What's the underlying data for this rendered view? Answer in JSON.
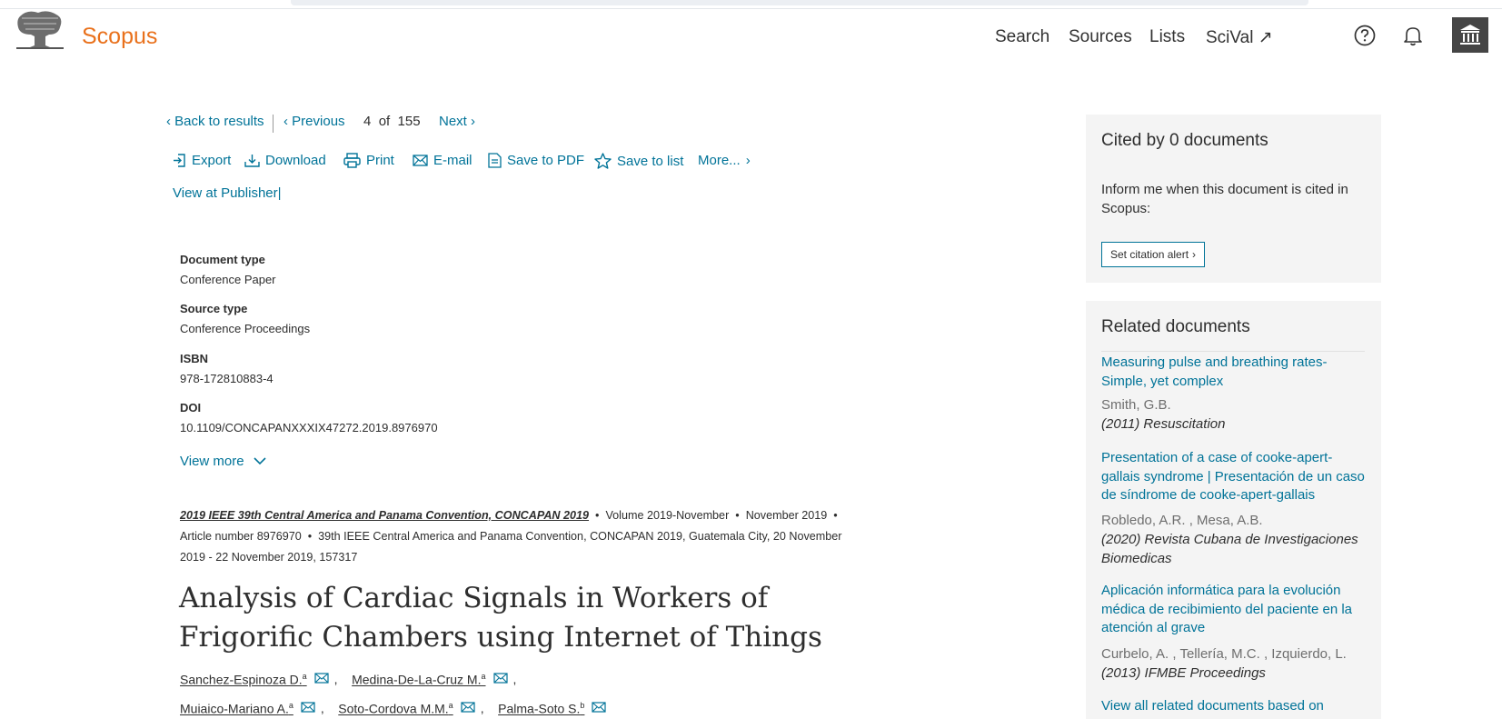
{
  "header": {
    "brand": "Scopus",
    "nav": {
      "search": "Search",
      "sources": "Sources",
      "lists": "Lists",
      "scival": "SciVal ↗"
    }
  },
  "nav": {
    "back": "Back to results",
    "previous": "Previous",
    "position": "4",
    "of": "of",
    "total": "155",
    "next": "Next"
  },
  "actions": {
    "export": "Export",
    "download": "Download",
    "print": "Print",
    "email": "E-mail",
    "save_pdf": "Save to PDF",
    "save_list": "Save to list",
    "more": "More...",
    "view_publisher": "View at Publisher|"
  },
  "metadata": {
    "document_type_label": "Document type",
    "document_type": "Conference Paper",
    "source_type_label": "Source type",
    "source_type": "Conference Proceedings",
    "isbn_label": "ISBN",
    "isbn": "978-172810883-4",
    "doi_label": "DOI",
    "doi": "10.1109/CONCAPANXXXIX47272.2019.8976970",
    "view_more": "View more"
  },
  "source": {
    "journal": "2019 IEEE 39th Central America and Panama Convention, CONCAPAN 2019",
    "volume": "Volume 2019-November",
    "date": "November 2019",
    "article": "Article number 8976970",
    "conference": "39th IEEE Central America and Panama Convention, CONCAPAN 2019, Guatemala City, 20 November 2019 - 22 November 2019, 157317"
  },
  "document": {
    "title": "Analysis of Cardiac Signals in Workers of Frigorific Chambers using Internet of Things"
  },
  "authors": [
    {
      "name": "Sanchez-Espinoza D.",
      "sup": "a"
    },
    {
      "name": "Medina-De-La-Cruz M.",
      "sup": "a"
    },
    {
      "name": "Muiaico-Mariano A.",
      "sup": "a"
    },
    {
      "name": "Soto-Cordova M.M.",
      "sup": "a"
    },
    {
      "name": "Palma-Soto S.",
      "sup": "b"
    }
  ],
  "cited": {
    "title": "Cited by 0 documents",
    "inform": "Inform me when this document is cited in Scopus:",
    "alert_button": "Set citation alert"
  },
  "related": {
    "title": "Related documents",
    "items": [
      {
        "title": "Measuring pulse and breathing rates-Simple, yet complex",
        "authors": "Smith, G.B.",
        "source": "(2011) Resuscitation"
      },
      {
        "title": "Presentation of a case of cooke-apert-gallais syndrome | Presentación de un caso de síndrome de cooke-apert-gallais",
        "authors": "Robledo, A.R. , Mesa, A.B.",
        "source": "(2020) Revista Cubana de Investigaciones Biomedicas"
      },
      {
        "title": "Aplicación informática para la evolución médica de recibimiento del paciente en la atención al grave",
        "authors": "Curbelo, A. , Tellería, M.C. , Izquierdo, L.",
        "source": "(2013) IFMBE Proceedings"
      }
    ],
    "view_all": "View all related documents based on"
  },
  "colors": {
    "link": "#007398",
    "brand": "#e9711c",
    "panel": "#f4f4f4"
  },
  "icons": [
    "elsevier-tree-logo",
    "help-icon",
    "bell-icon",
    "institution-icon",
    "export-icon",
    "download-icon",
    "print-icon",
    "mail-icon",
    "pdf-icon",
    "star-icon",
    "chevron-left-icon",
    "chevron-right-icon",
    "chevron-down-icon"
  ]
}
